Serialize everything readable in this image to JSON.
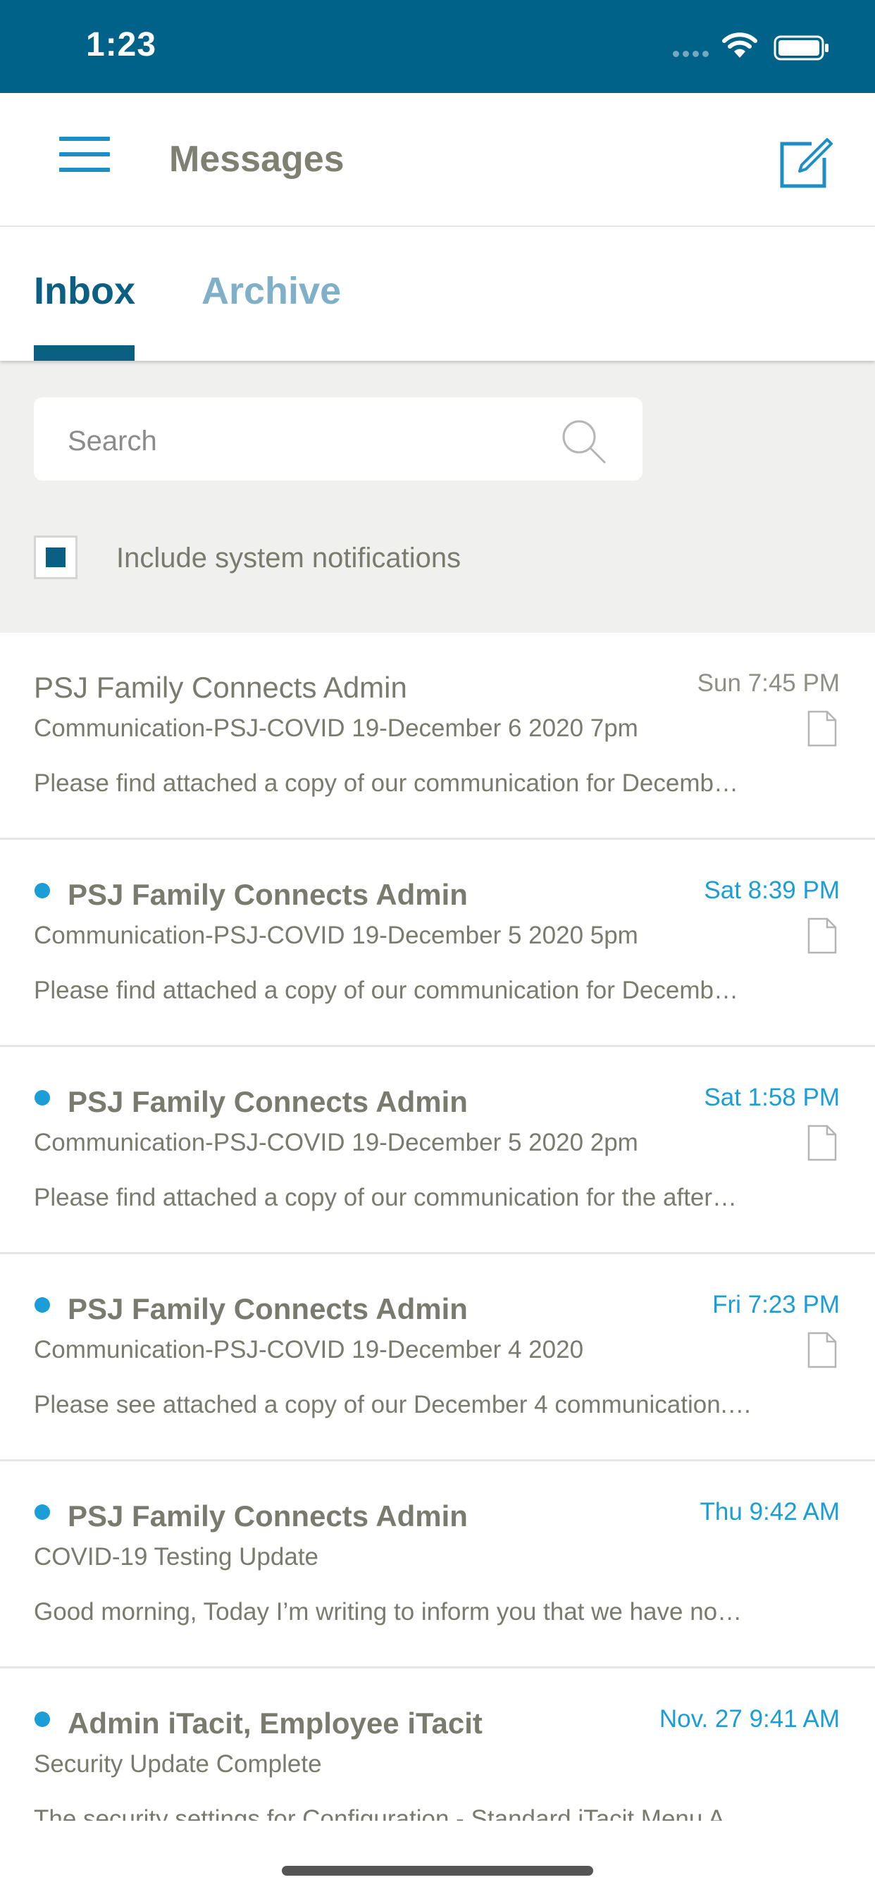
{
  "status_bar": {
    "time": "1:23"
  },
  "header": {
    "title": "Messages"
  },
  "tabs": [
    {
      "label": "Inbox"
    },
    {
      "label": "Archive"
    }
  ],
  "search": {
    "placeholder": "Search"
  },
  "filters": {
    "include_system_label": "Include system notifications",
    "include_system_checked": true
  },
  "colors": {
    "brand": "#006189",
    "accent": "#1b9ed8",
    "text": "#7a7a6e",
    "tab_active": "#0b5f83",
    "tab_inactive": "#7fb0c8"
  },
  "icons": {
    "menu": "hamburger-icon",
    "compose": "compose-icon",
    "search": "search-icon",
    "attachment": "attachment-icon"
  },
  "messages": [
    {
      "sender": "PSJ Family Connects Admin",
      "time": "Sun 7:45 PM",
      "subject": "Communication-PSJ-COVID 19-December 6 2020 7pm",
      "preview": "Please find attached a copy of our communication for Decemb…",
      "unread": false,
      "attachment": true
    },
    {
      "sender": "PSJ Family Connects Admin",
      "time": "Sat 8:39 PM",
      "subject": "Communication-PSJ-COVID 19-December 5 2020 5pm",
      "preview": "Please find attached a copy of our communication for Decemb…",
      "unread": true,
      "attachment": true
    },
    {
      "sender": "PSJ Family Connects Admin",
      "time": "Sat 1:58 PM",
      "subject": "Communication-PSJ-COVID 19-December 5 2020 2pm",
      "preview": "Please find attached a copy of our communication for the after…",
      "unread": true,
      "attachment": true
    },
    {
      "sender": "PSJ Family Connects Admin",
      "time": "Fri 7:23 PM",
      "subject": "Communication-PSJ-COVID 19-December 4 2020",
      "preview": "Please see attached a copy of our December 4 communication.…",
      "unread": true,
      "attachment": true
    },
    {
      "sender": "PSJ Family Connects Admin",
      "time": "Thu 9:42 AM",
      "subject": "COVID-19 Testing Update",
      "preview": "Good morning, Today I’m writing to inform you that we have no…",
      "unread": true,
      "attachment": false
    },
    {
      "sender": "Admin iTacit, Employee iTacit",
      "time": "Nov. 27 9:41 AM",
      "subject": "Security Update Complete",
      "preview": "The security settings for Configuration - Standard iTacit Menu A…",
      "unread": true,
      "attachment": false
    }
  ]
}
